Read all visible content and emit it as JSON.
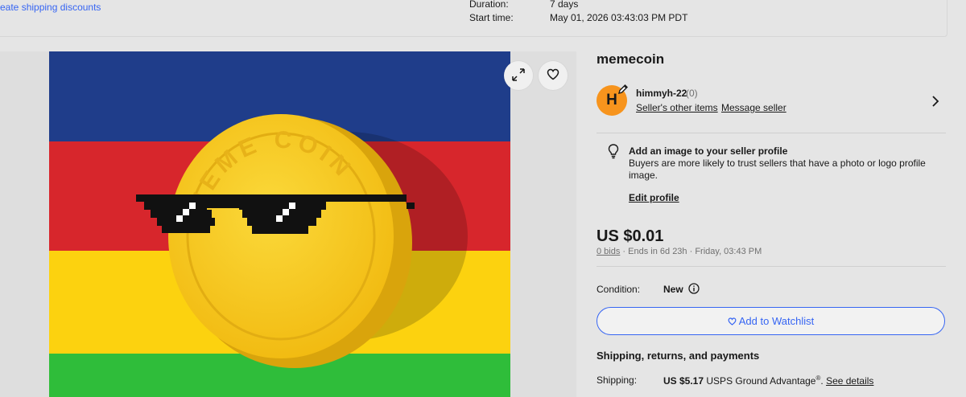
{
  "top": {
    "discount_link": "eate shipping discounts",
    "duration_label": "Duration:",
    "duration_value": "7 days",
    "start_label": "Start time:",
    "start_value": "May 01, 2026 03:43:03 PM PDT"
  },
  "item": {
    "title": "memecoin",
    "coin_text": "MEME COIN"
  },
  "seller": {
    "avatar_letter": "H",
    "name": "himmyh-22",
    "score": "(0)",
    "other_items": "Seller's other items",
    "message": "Message seller"
  },
  "tip": {
    "title": "Add an image to your seller profile",
    "body": "Buyers are more likely to trust sellers that have a photo or logo profile image.",
    "link": "Edit profile"
  },
  "pricing": {
    "price": "US $0.01",
    "bids": "0 bids",
    "ends": "Ends in 6d 23h · Friday, 03:43 PM"
  },
  "condition": {
    "label": "Condition:",
    "value": "New"
  },
  "watchlist": {
    "label": "Add to Watchlist"
  },
  "shipping": {
    "heading": "Shipping, returns, and payments",
    "label": "Shipping:",
    "amount": "US $5.17",
    "service": "USPS Ground Advantage",
    "service_mark": "®",
    "details": "See details"
  },
  "colors": {
    "accent": "#3665f3",
    "avatar": "#f7941d",
    "flag_blue": "#1f3d8a",
    "flag_red": "#d7262c",
    "flag_yellow": "#fcd20f",
    "flag_green": "#2fbd3a",
    "coin": "#f6c51c"
  },
  "icons": [
    "expand-icon",
    "heart-icon",
    "pencil-icon",
    "chevron-right-icon",
    "lightbulb-icon",
    "info-icon"
  ]
}
